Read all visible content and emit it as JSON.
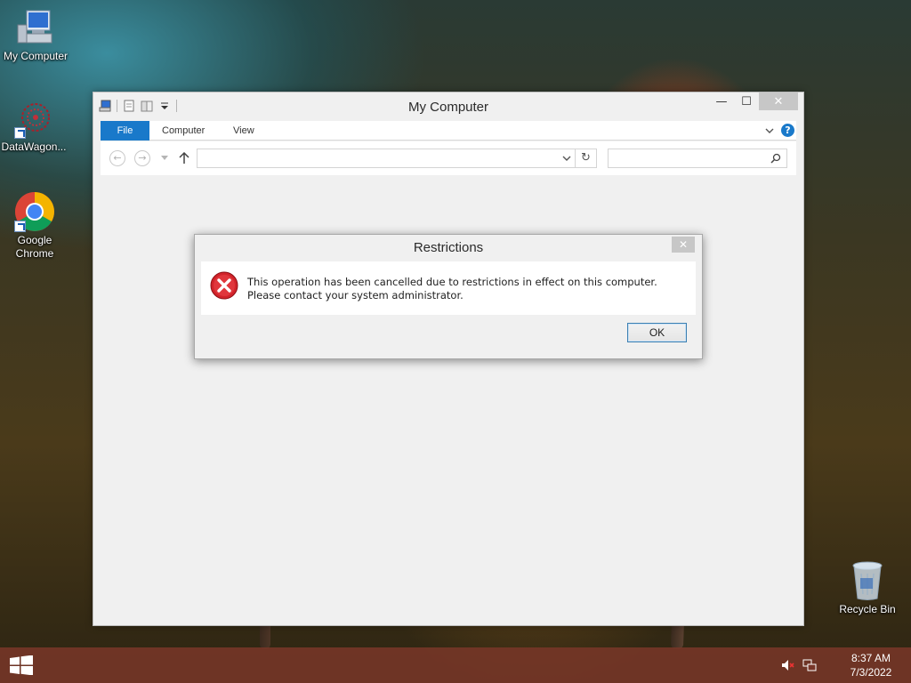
{
  "desktop": {
    "icons": [
      {
        "label": "My Computer",
        "icon": "my-computer-icon"
      },
      {
        "label": "DataWagon...",
        "icon": "datawagon-icon"
      },
      {
        "label": "Google Chrome",
        "icon": "chrome-icon"
      },
      {
        "label": "Recycle Bin",
        "icon": "recycle-bin-icon"
      }
    ]
  },
  "explorer": {
    "title": "My Computer",
    "ribbon_tabs": [
      "File",
      "Computer",
      "View"
    ],
    "address_value": "",
    "search_placeholder": "",
    "controls": {
      "minimize": "—",
      "maximize": "☐",
      "close": "✕"
    }
  },
  "dialog": {
    "title": "Restrictions",
    "message": "This operation has been cancelled due to restrictions in effect on this computer. Please contact your system administrator.",
    "ok_label": "OK",
    "close_label": "✕",
    "icon": "error-icon"
  },
  "taskbar": {
    "time": "8:37 AM",
    "date": "7/3/2022",
    "tray_icons": [
      "volume-muted-icon",
      "network-icon"
    ]
  },
  "colors": {
    "accent": "#1979ca",
    "taskbar": "#78372a",
    "error": "#d1232a"
  }
}
